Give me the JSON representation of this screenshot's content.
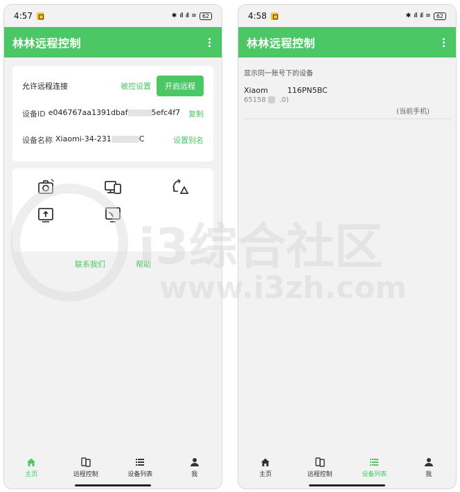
{
  "left": {
    "status": {
      "time": "4:57",
      "battery": "62",
      "signal": "ᵈᵃᵗᵃ"
    },
    "app_title": "林林远程控制",
    "connection": {
      "allow_label": "允许远程连接",
      "controlled_settings": "被控设置",
      "start_remote": "开启远程",
      "device_id_label": "设备ID",
      "device_id_value_start": "e046767aa1391dbaf",
      "device_id_value_end": "5efc4f7",
      "copy": "复制",
      "device_name_label": "设备名称",
      "device_name_value_start": "Xiaomi-34-231",
      "device_name_value_end": "C",
      "set_alias": "设置别名"
    },
    "tools": [
      {
        "label": "远程相机设置",
        "icon": "camera-icon"
      },
      {
        "label": "电脑控制手机",
        "icon": "pc-phone-icon"
      },
      {
        "label": "允许网络转发",
        "icon": "network-forward-icon"
      },
      {
        "label": "扫码投屏",
        "icon": "scan-cast-icon"
      },
      {
        "label": "接收投屏",
        "icon": "receive-cast-icon"
      }
    ],
    "links": {
      "contact": "联系我们",
      "help": "帮助"
    }
  },
  "right": {
    "status": {
      "time": "4:58",
      "battery": "62"
    },
    "app_title": "林林远程控制",
    "list_header": "显示同一账号下的设备",
    "device": {
      "name_start": "Xiaom",
      "name_end": "116PN5BC",
      "id_start": "65158",
      "id_end": ".0)",
      "current": "(当前手机)"
    }
  },
  "tabs": [
    {
      "label": "主页",
      "icon": "home-icon"
    },
    {
      "label": "远程控制",
      "icon": "remote-control-icon"
    },
    {
      "label": "设备列表",
      "icon": "device-list-icon"
    },
    {
      "label": "我",
      "icon": "user-icon"
    }
  ],
  "colors": {
    "accent": "#4cc766",
    "background": "#f2f2f2"
  },
  "watermark": {
    "text": "i3综合社区",
    "url": "www.i3zh.com"
  }
}
